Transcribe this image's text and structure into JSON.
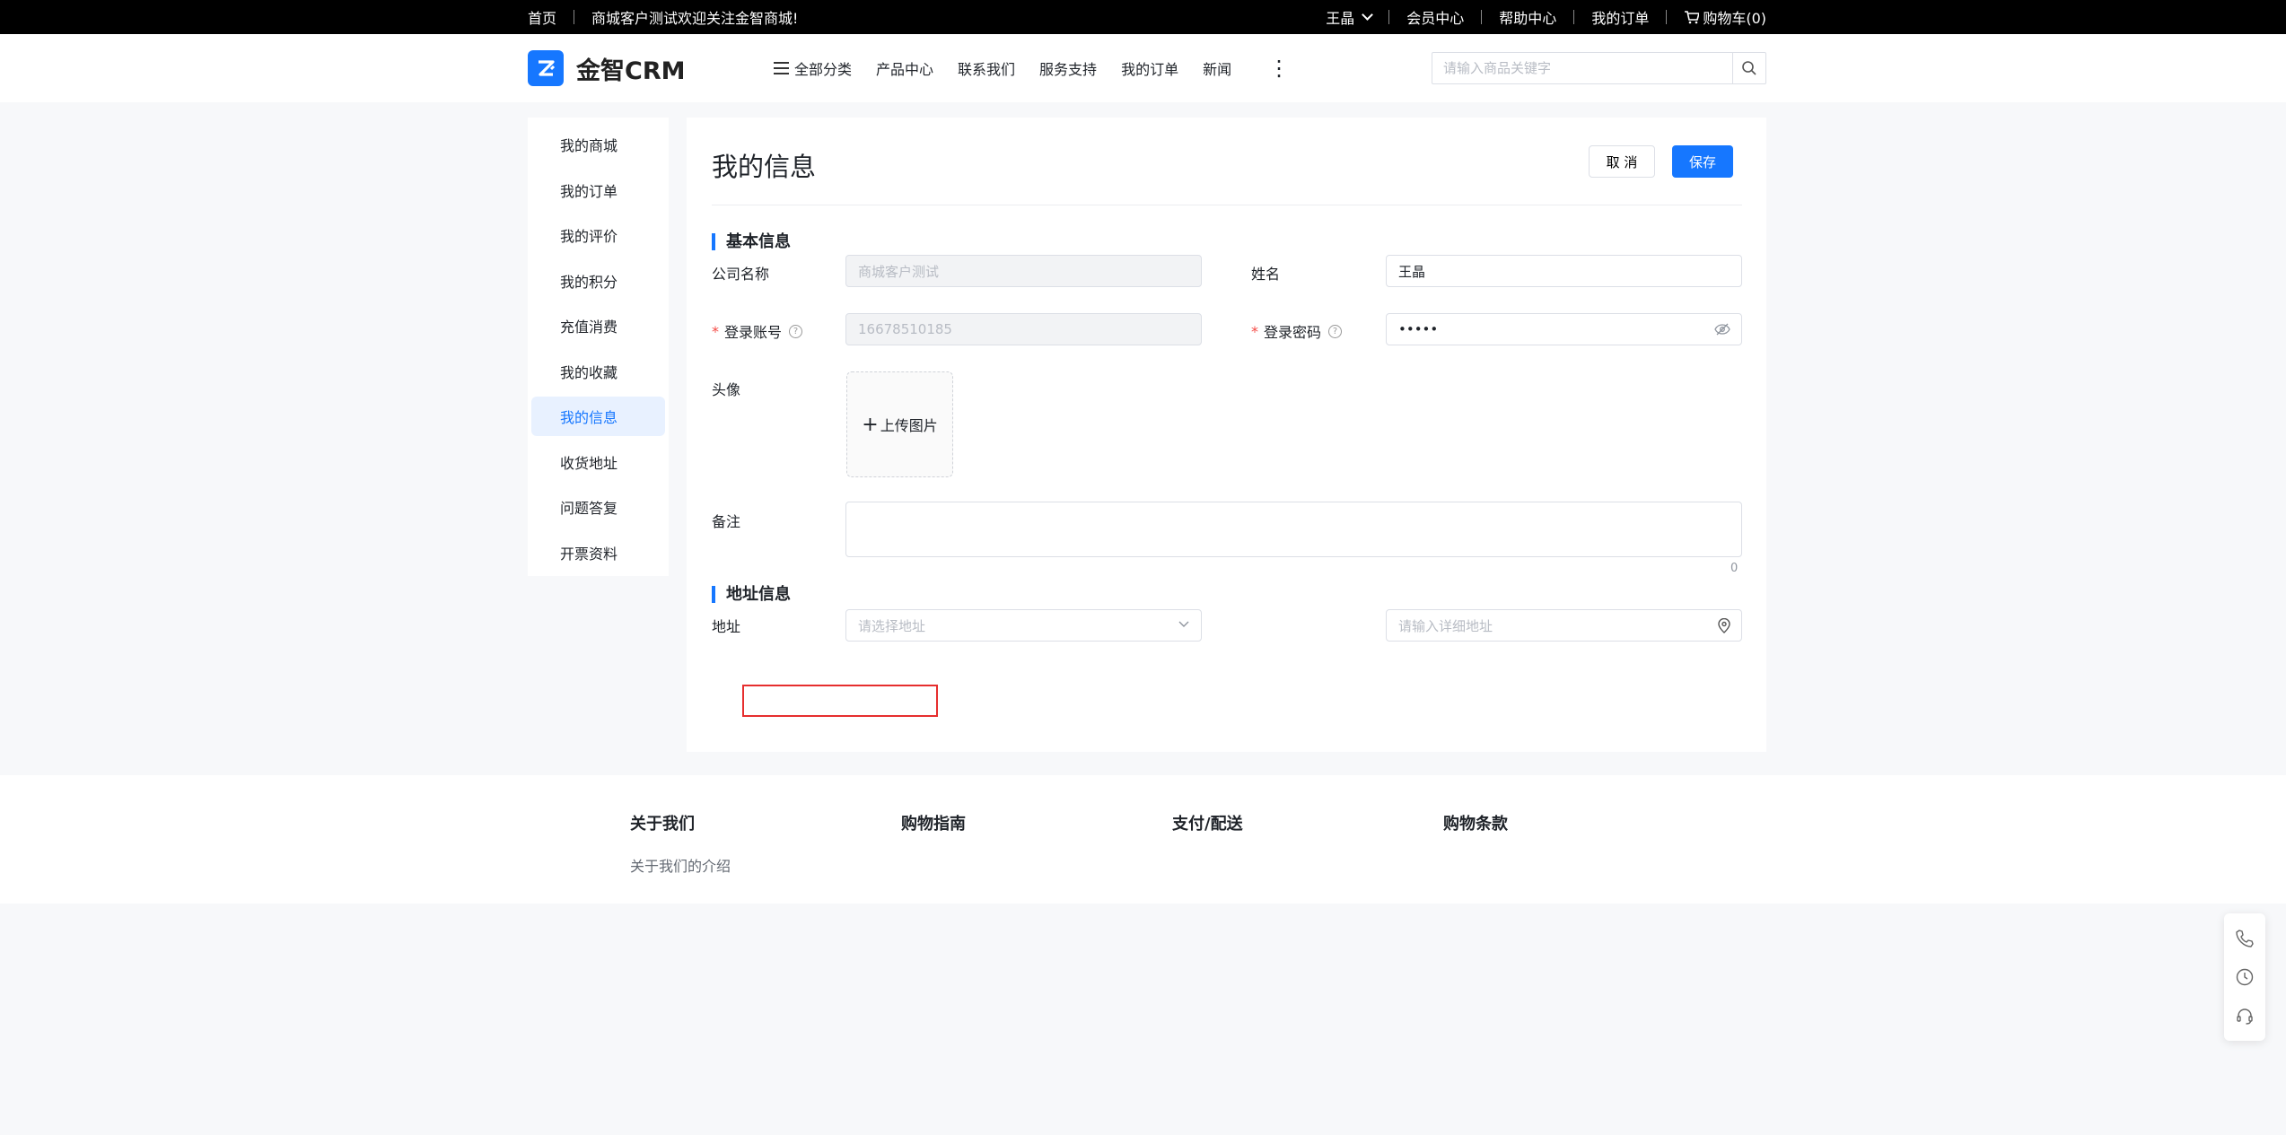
{
  "topbar": {
    "home": "首页",
    "welcome": "商城客户测试欢迎关注金智商城!",
    "user": "王晶",
    "member_center": "会员中心",
    "help_center": "帮助中心",
    "my_orders": "我的订单",
    "cart": "购物车(0)"
  },
  "header": {
    "logo_text": "金智CRM",
    "nav": {
      "all_categories": "全部分类",
      "products": "产品中心",
      "contact": "联系我们",
      "service": "服务支持",
      "orders": "我的订单",
      "news": "新闻",
      "more": "⋮"
    },
    "search_placeholder": "请输入商品关键字"
  },
  "sidebar": {
    "items": [
      {
        "label": "我的商城"
      },
      {
        "label": "我的订单"
      },
      {
        "label": "我的评价"
      },
      {
        "label": "我的积分"
      },
      {
        "label": "充值消费"
      },
      {
        "label": "我的收藏"
      },
      {
        "label": "我的信息",
        "active": true
      },
      {
        "label": "收货地址"
      },
      {
        "label": "问题答复"
      },
      {
        "label": "开票资料"
      }
    ]
  },
  "main": {
    "title": "我的信息",
    "cancel": "取 消",
    "save": "保存",
    "basic_section": "基本信息",
    "company_label": "公司名称",
    "company_value": "商城客户测试",
    "name_label": "姓名",
    "name_value": "王晶",
    "account_required": "*",
    "account_label": "登录账号",
    "account_value": "16678510185",
    "password_required": "*",
    "password_label": "登录密码",
    "password_value": "•••••",
    "avatar_label": "头像",
    "upload_label": "上传图片",
    "remark_label": "备注",
    "remark_count": "0",
    "address_section": "地址信息",
    "address_label": "地址",
    "address_placeholder": "请选择地址",
    "detail_address_placeholder": "请输入详细地址"
  },
  "footer": {
    "about": "关于我们",
    "about_link": "关于我们的介绍",
    "guide": "购物指南",
    "payment": "支付/配送",
    "terms": "购物条款"
  },
  "colors": {
    "accent": "#1677ff",
    "required": "#f54a45",
    "highlight_box": "#e62e2e"
  }
}
